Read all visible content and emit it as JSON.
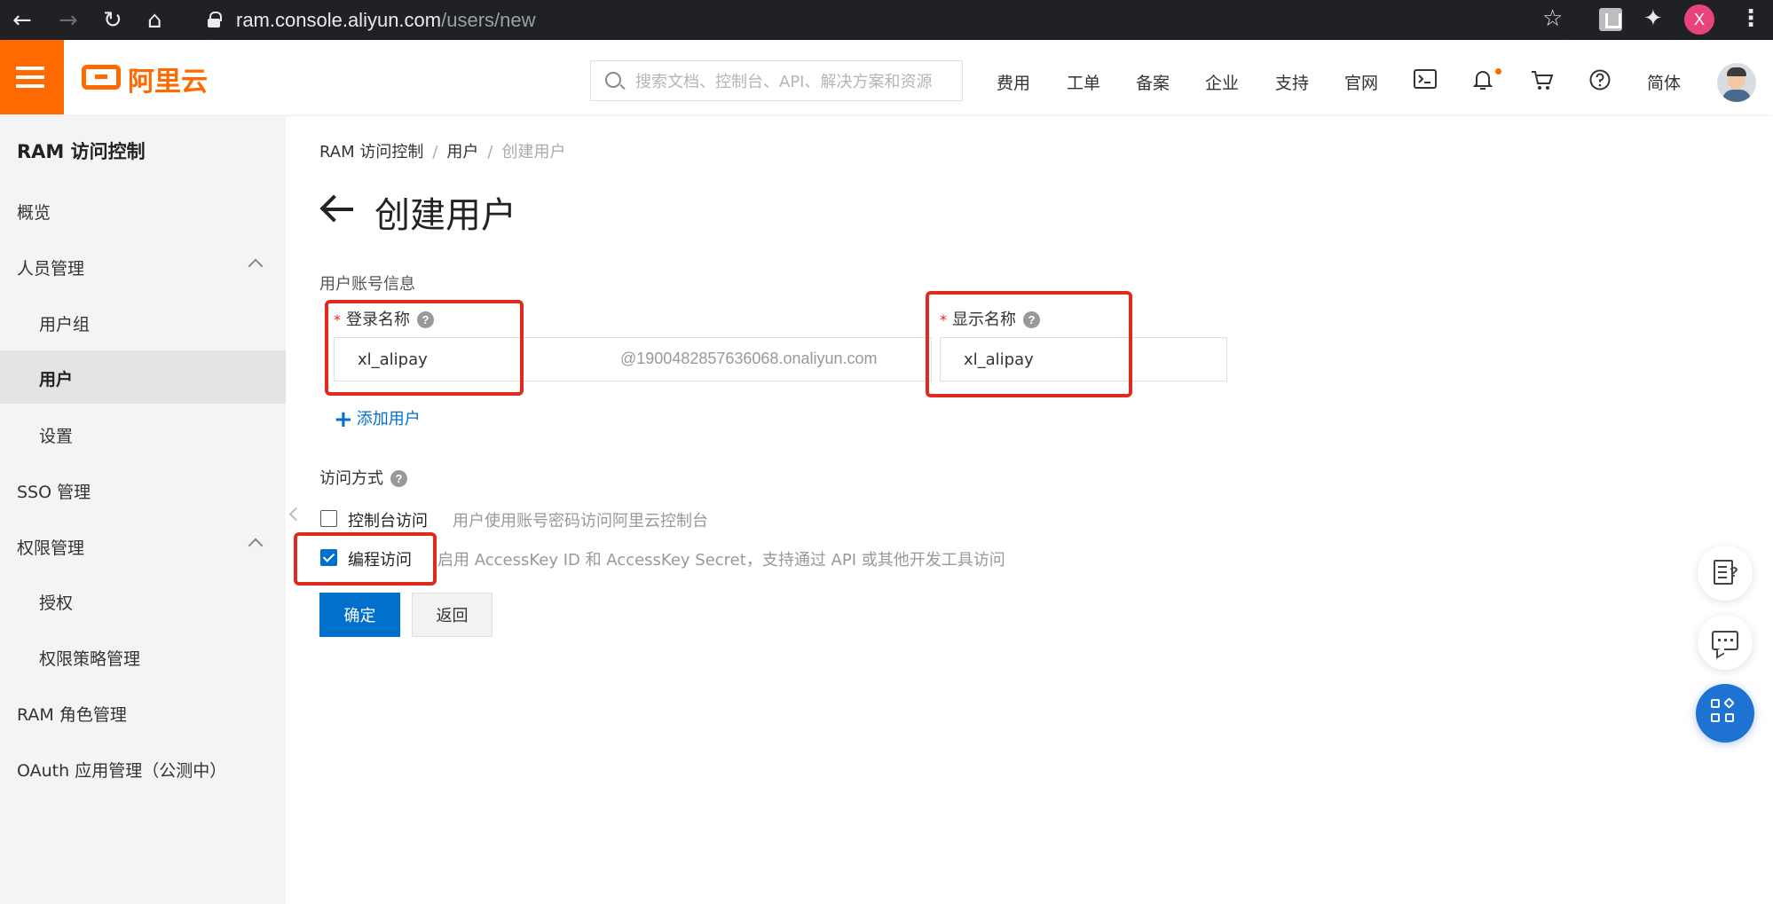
{
  "browser": {
    "url_host": "ram.console.aliyun.com",
    "url_path": "/users/new",
    "profile_initial": "X"
  },
  "topnav": {
    "logo_text": "阿里云",
    "search_placeholder": "搜索文档、控制台、API、解决方案和资源",
    "links": [
      "费用",
      "工单",
      "备案",
      "企业",
      "支持",
      "官网"
    ],
    "lang": "简体"
  },
  "sidebar": {
    "title": "RAM 访问控制",
    "items": [
      {
        "label": "概览"
      },
      {
        "label": "人员管理"
      },
      {
        "label": "用户组"
      },
      {
        "label": "用户"
      },
      {
        "label": "设置"
      },
      {
        "label": "SSO 管理"
      },
      {
        "label": "权限管理"
      },
      {
        "label": "授权"
      },
      {
        "label": "权限策略管理"
      },
      {
        "label": "RAM 角色管理"
      },
      {
        "label": "OAuth 应用管理（公测中）"
      }
    ]
  },
  "breadcrumb": {
    "items": [
      "RAM 访问控制",
      "用户",
      "创建用户"
    ],
    "sep": "/"
  },
  "page": {
    "title": "创建用户"
  },
  "form": {
    "section_account": "用户账号信息",
    "login_name_label": "登录名称",
    "login_name_value": "xl_alipay",
    "login_suffix": "@1900482857636068.onaliyun.com",
    "display_name_label": "显示名称",
    "display_name_value": "xl_alipay",
    "required_mark": "*",
    "help_mark": "?",
    "add_user": "添加用户",
    "access_label": "访问方式",
    "console_access_label": "控制台访问",
    "console_access_desc": "用户使用账号密码访问阿里云控制台",
    "console_access_checked": false,
    "program_access_label": "编程访问",
    "program_access_desc": "启用 AccessKey ID 和 AccessKey Secret，支持通过 API 或其他开发工具访问",
    "program_access_checked": true,
    "confirm_button": "确定",
    "back_button": "返回"
  },
  "colors": {
    "brand_orange": "#ff6a00",
    "primary_blue": "#0070cc",
    "annotation_red": "#e0291f"
  },
  "icons": {
    "nav": [
      "terminal-icon",
      "bell-icon",
      "cart-icon",
      "help-icon"
    ],
    "floating": [
      "feedback-doc-icon",
      "chat-icon",
      "apps-grid-icon"
    ]
  }
}
